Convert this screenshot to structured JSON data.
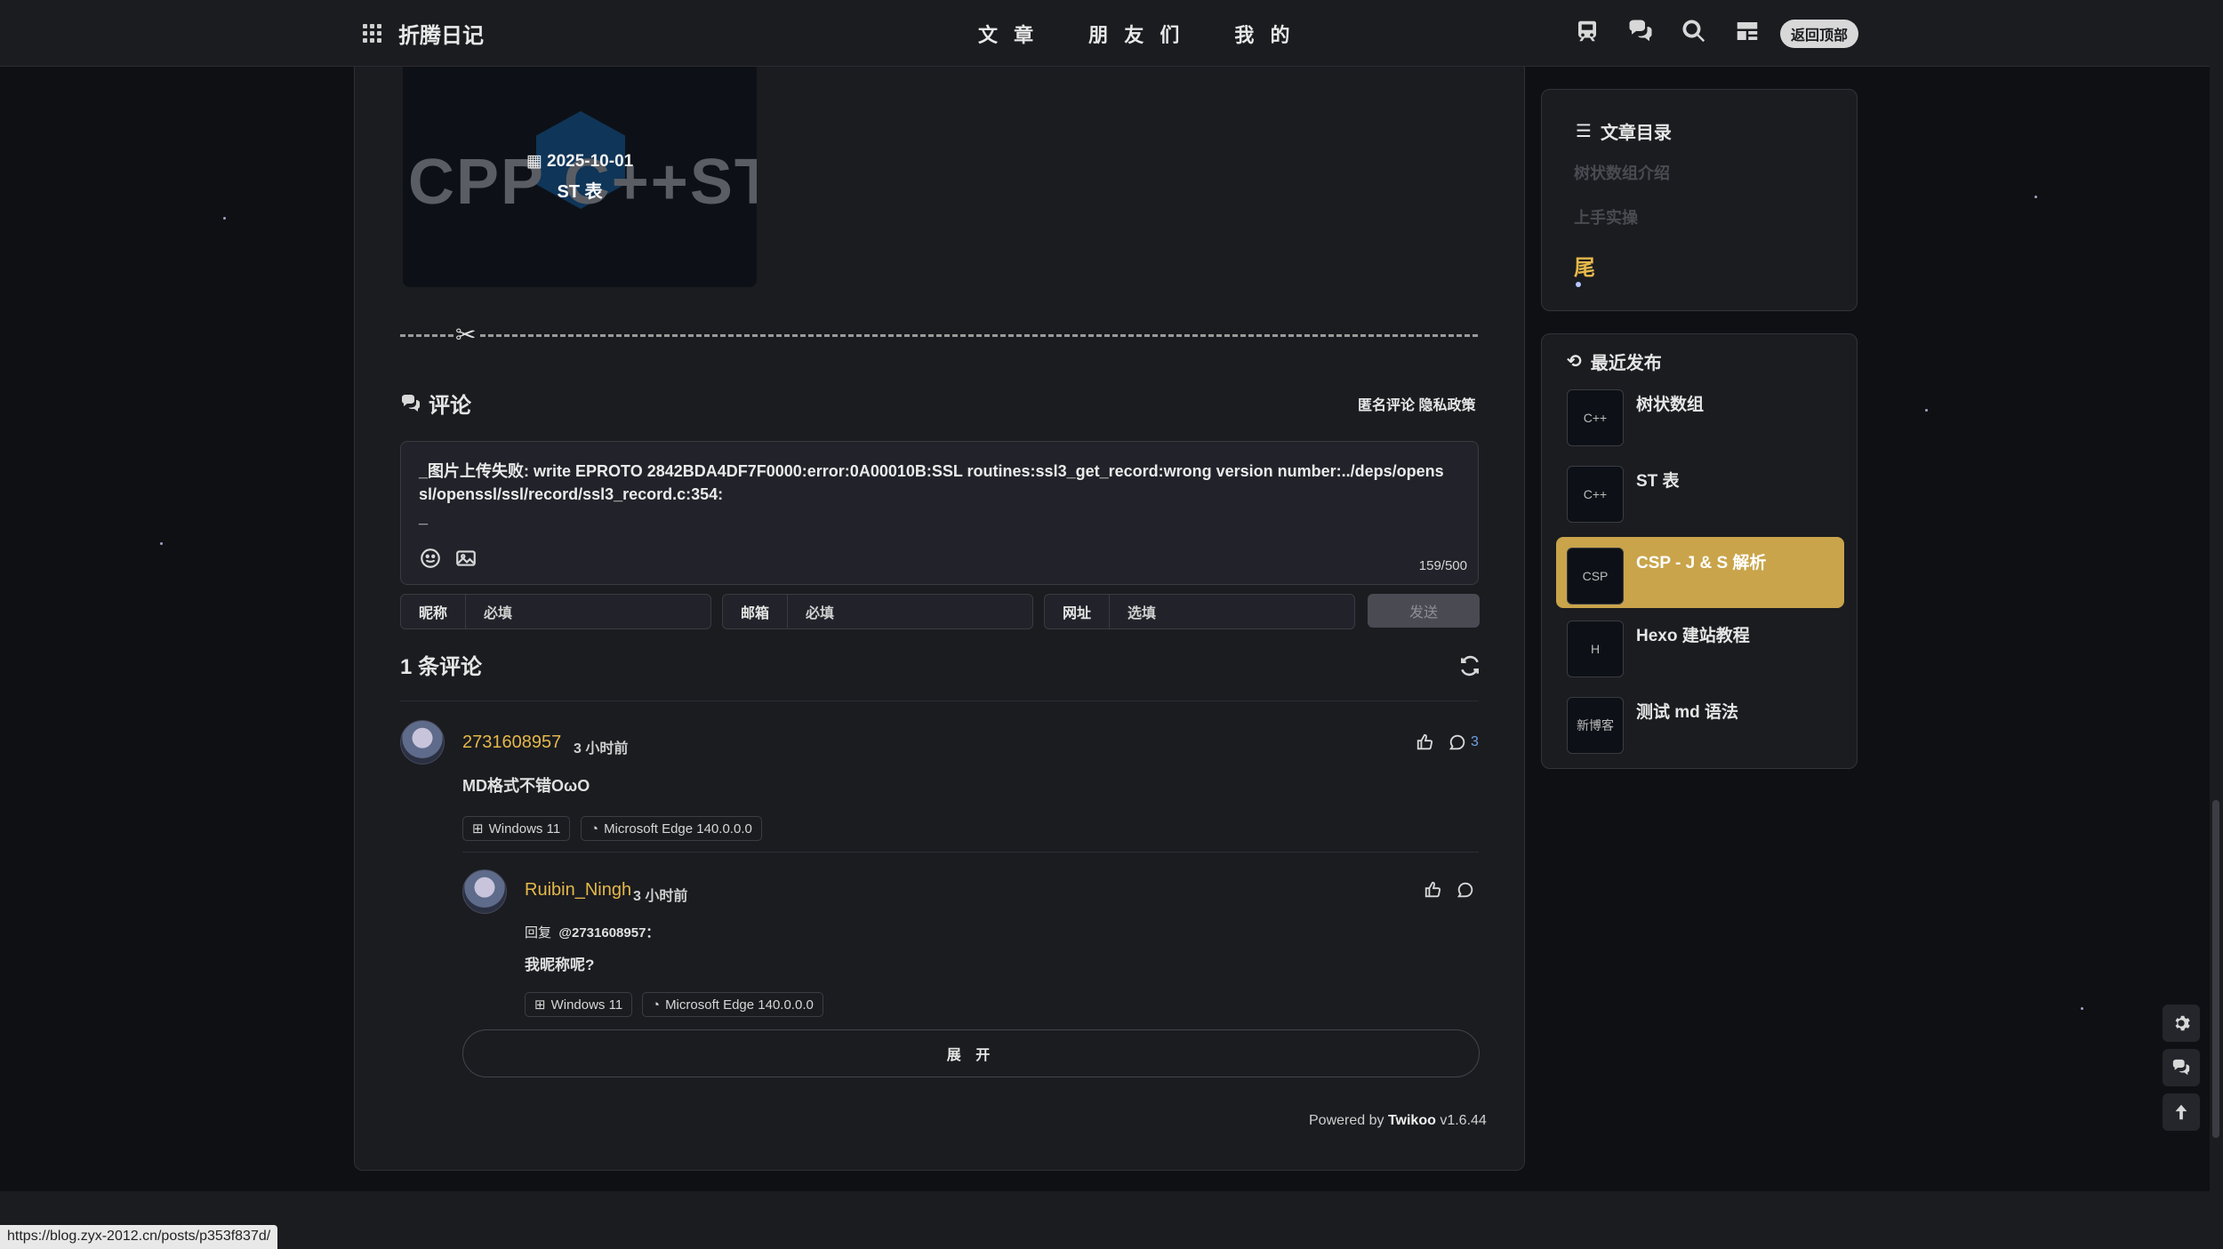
{
  "header": {
    "brand": "折腾日记",
    "nav": [
      "文 章",
      "朋 友 们",
      "我 的"
    ],
    "back_to_top": "返回顶部",
    "icons": [
      "train-icon",
      "chat-icon",
      "search-icon",
      "layout-icon"
    ]
  },
  "post": {
    "thumb_bg_text": "CPP C++ST表",
    "date": "2025-10-01",
    "name": "ST 表"
  },
  "comments": {
    "title": "评论",
    "links": "匿名评论 隐私政策",
    "editor_text": "_图片上传失败: write EPROTO 2842BDA4DF7F0000:error:0A00010B:SSL routines:ssl3_get_record:wrong version number:../deps/openssl/openssl/ssl/record/ssl3_record.c:354:\n_",
    "counter": "159/500",
    "fields": [
      {
        "label": "昵称",
        "placeholder": "必填"
      },
      {
        "label": "邮箱",
        "placeholder": "必填"
      },
      {
        "label": "网址",
        "placeholder": "选填"
      }
    ],
    "send": "发送",
    "count_label": "1 条评论",
    "list": [
      {
        "name": "2731608957",
        "time": "3 小时前",
        "text": "MD格式不错OωO",
        "os": "Windows 11",
        "browser": "Microsoft Edge 140.0.0.0",
        "reply_count": "3"
      }
    ],
    "reply": {
      "name": "Ruibin_Ningh",
      "time": "3 小时前",
      "reply_prefix": "回复",
      "reply_to": "@2731608957",
      "reply_colon": "：",
      "text": "我昵称呢?",
      "os": "Windows 11",
      "browser": "Microsoft Edge 140.0.0.0"
    },
    "expand": "展 开",
    "powered_prefix": "Powered by",
    "powered_name": "Twikoo",
    "powered_version": "v1.6.44"
  },
  "toc": {
    "title": "文章目录",
    "items": [
      "树状数组介绍",
      "上手实操"
    ],
    "active": "尾"
  },
  "recent": {
    "title": "最近发布",
    "items": [
      {
        "label": "树状数组",
        "thumb": "C++"
      },
      {
        "label": "ST 表",
        "thumb": "C++"
      },
      {
        "label": "CSP - J & S 解析",
        "thumb": "CSP"
      },
      {
        "label": "Hexo 建站教程",
        "thumb": "H"
      },
      {
        "label": "测试 md 语法",
        "thumb": "新博客"
      }
    ]
  },
  "status_url": "https://blog.zyx-2012.cn/posts/p353f837d/",
  "colors": {
    "accent": "#e4b84a",
    "active_bg": "#c9a44a",
    "bg": "#0f1014",
    "card": "#1b1c20"
  }
}
